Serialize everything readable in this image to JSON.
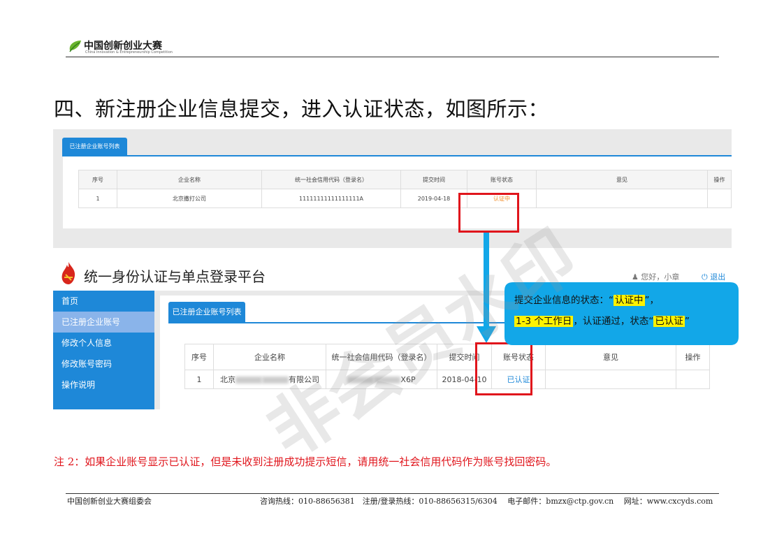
{
  "header": {
    "logo_title": "中国创新创业大赛",
    "logo_subtitle": "China Innovation & Entrepreneurship Competition"
  },
  "heading": "四、新注册企业信息提交，进入认证状态，如图所示：",
  "shot1": {
    "tab_label": "已注册企业账号列表",
    "columns": [
      "序号",
      "企业名称",
      "统一社会信用代码（登录名）",
      "提交时间",
      "账号状态",
      "意见",
      "操作"
    ],
    "row": {
      "index": "1",
      "company": "北京撒打公司",
      "code": "11111111111111111A",
      "time": "2019-04-18",
      "status": "认证中",
      "opinion": "",
      "action": ""
    },
    "status_color": "#f08a24"
  },
  "shot2": {
    "platform_title": "统一身份认证与单点登录平台",
    "user_greeting": "您好，小章",
    "logout_label": "退出",
    "sidebar": [
      {
        "label": "首页",
        "active": false
      },
      {
        "label": "已注册企业账号",
        "active": true
      },
      {
        "label": "修改个人信息",
        "active": false
      },
      {
        "label": "修改账号密码",
        "active": false
      },
      {
        "label": "操作说明",
        "active": false
      }
    ],
    "tab_label": "已注册企业账号列表",
    "columns": [
      "序号",
      "企业名称",
      "统一社会信用代码（登录名）",
      "提交时间",
      "账号状态",
      "意见",
      "操作"
    ],
    "row": {
      "index": "1",
      "company_prefix": "北京",
      "company_suffix": "有限公司",
      "code_suffix": "X6P",
      "time": "2018-04-10",
      "status": "已认证",
      "opinion": "",
      "action": ""
    },
    "accent_color": "#1e88d8"
  },
  "callout": {
    "line1_prefix": "提交企业信息的状态：“",
    "line1_highlight": "认证中",
    "line1_suffix": "”，",
    "line2_highlight1": "1-3 个工作日",
    "line2_middle": "，认证通过，状态“",
    "line2_highlight2": "已认证",
    "line2_suffix": "”",
    "bg_color": "#12a7e8"
  },
  "watermark": "非会员水印",
  "note": "注 2：如果企业账号显示已认证，但是未收到注册成功提示短信，请用统一社会信用代码作为账号找回密码。",
  "footer": {
    "org": "中国创新创业大赛组委会",
    "contacts": "咨询热线：010-88656381　注册/登录热线：010-88656315/6304　 电子邮件：bmzx@ctp.gov.cn　 网址：www.cxcyds.com"
  }
}
